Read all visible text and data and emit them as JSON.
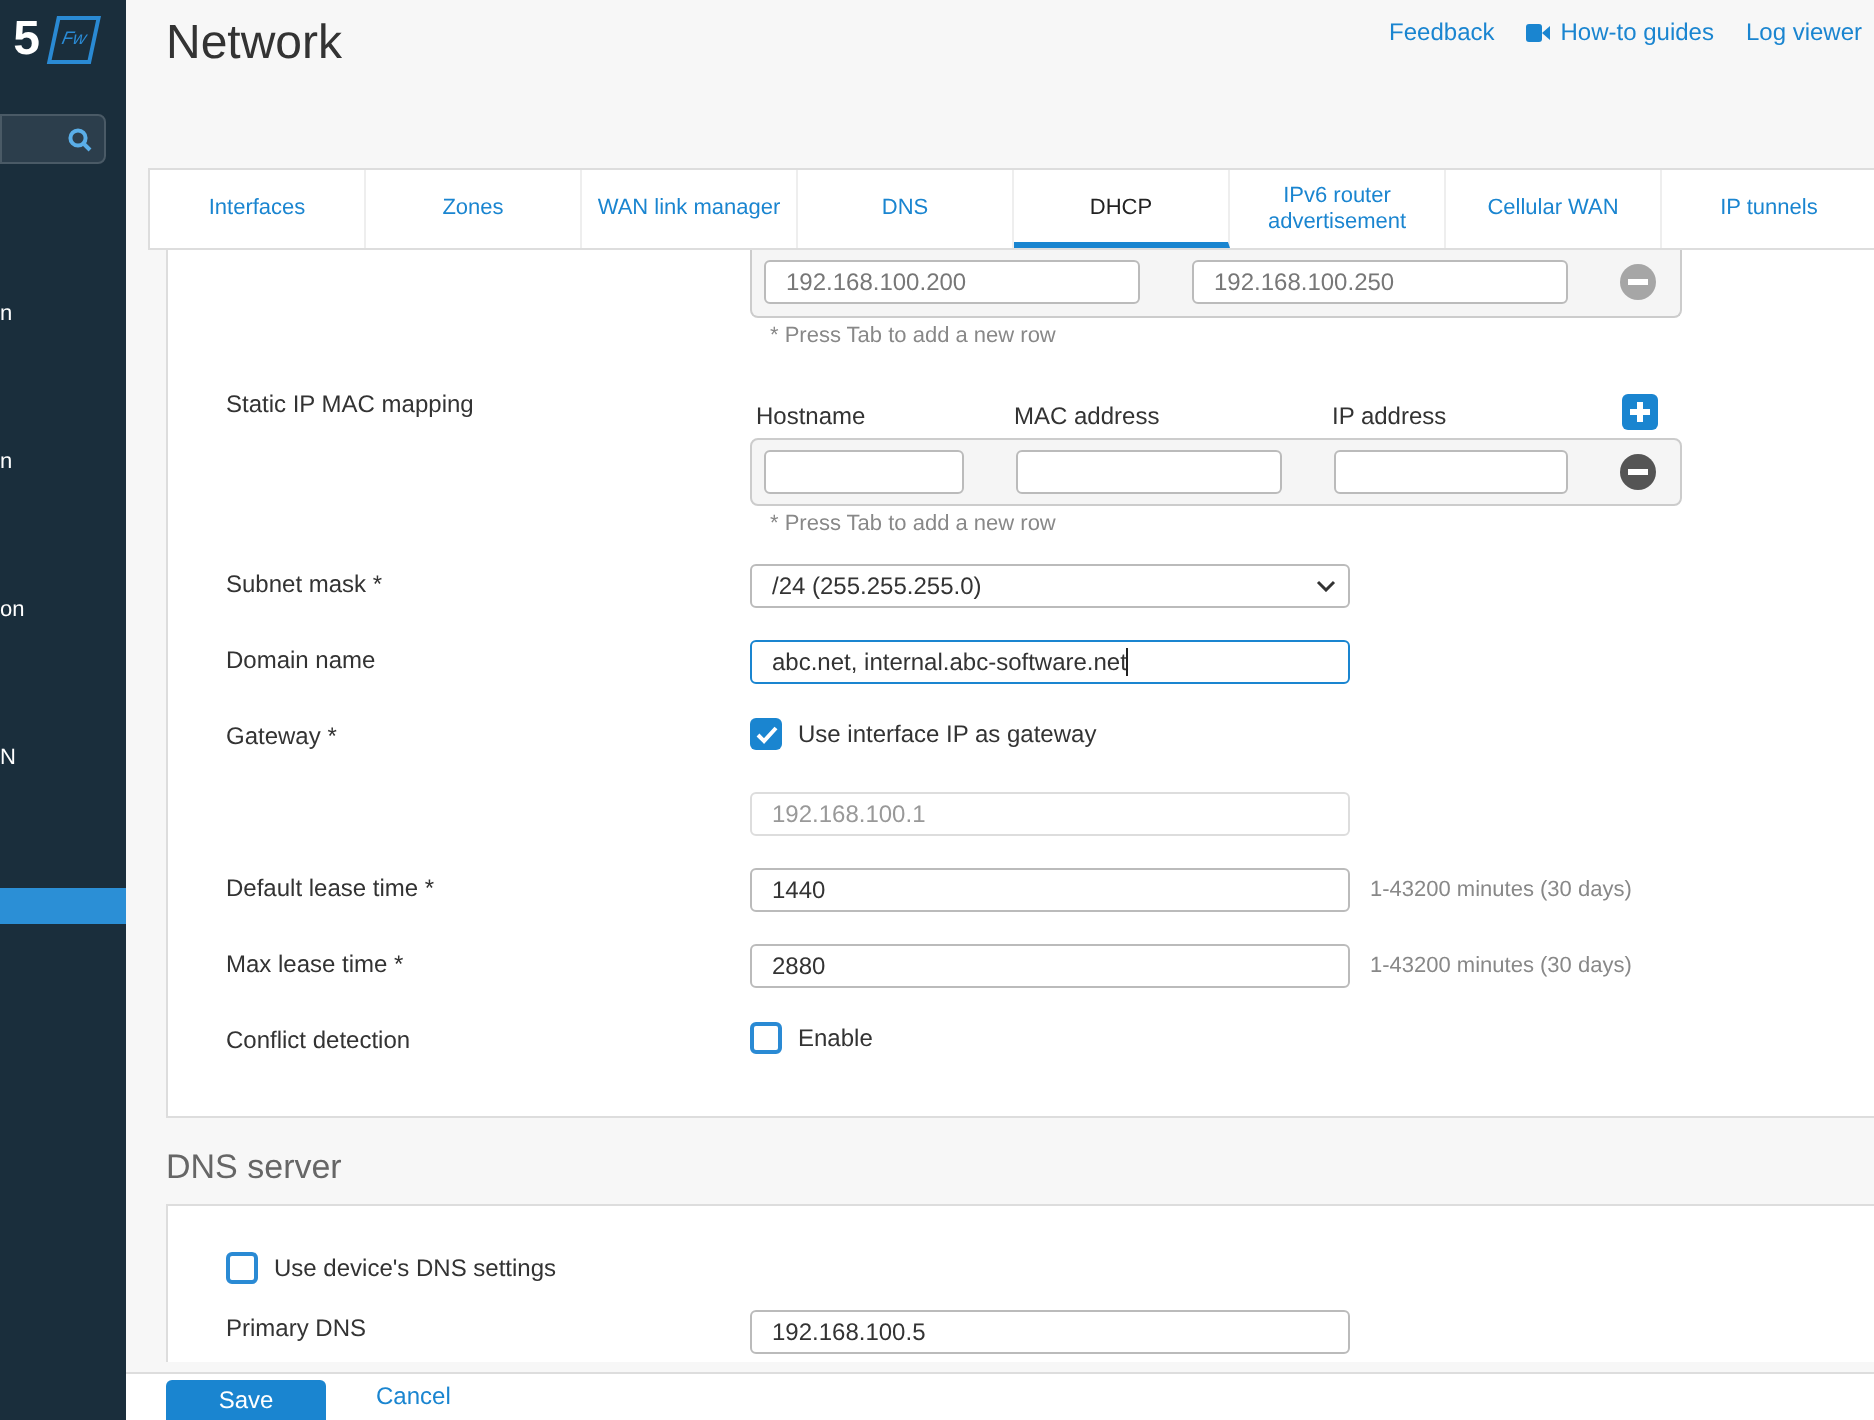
{
  "sidebar": {
    "logo": {
      "mark": "5",
      "badge": "Fw"
    },
    "items": [
      {
        "label": "n",
        "selected": false
      },
      {
        "label": "n",
        "selected": false
      },
      {
        "label": "on",
        "selected": false
      },
      {
        "label": "N",
        "selected": false
      },
      {
        "selected": true
      }
    ]
  },
  "header": {
    "title": "Network",
    "links": [
      {
        "label": "Feedback",
        "kind": "plain"
      },
      {
        "label": "How-to guides",
        "kind": "video"
      },
      {
        "label": "Log viewer",
        "kind": "plain"
      }
    ]
  },
  "tabs": [
    {
      "label": "Interfaces",
      "selected": false
    },
    {
      "label": "Zones",
      "selected": false
    },
    {
      "label": "WAN link manager",
      "selected": false
    },
    {
      "label": "DNS",
      "selected": false
    },
    {
      "label": "DHCP",
      "selected": true
    },
    {
      "label": "IPv6 router advertisement",
      "selected": false
    },
    {
      "label": "Cellular WAN",
      "selected": false
    },
    {
      "label": "IP tunnels",
      "selected": false
    }
  ],
  "dhcp": {
    "range_rows": [
      {
        "start": "192.168.100.200",
        "end": "192.168.100.250"
      }
    ],
    "range_hint": "* Press Tab to add a new row",
    "static_mapping": {
      "label": "Static IP MAC mapping",
      "columns": [
        "Hostname",
        "MAC address",
        "IP address"
      ],
      "hint": "* Press Tab to add a new row"
    },
    "fields": [
      {
        "kind": "select",
        "label": "Subnet mask *",
        "value": "/24 (255.255.255.0)"
      },
      {
        "kind": "text",
        "label": "Domain name",
        "value": "abc.net, internal.abc-software.net",
        "focused": true
      },
      {
        "kind": "checkbox",
        "label": "Gateway *",
        "text": "Use interface IP as gateway",
        "checked": true
      },
      {
        "kind": "text",
        "value": "192.168.100.1",
        "disabled": true
      },
      {
        "kind": "text",
        "label": "Default lease time *",
        "value": "1440",
        "hint": "1-43200 minutes (30 days)"
      },
      {
        "kind": "text",
        "label": "Max lease time *",
        "value": "2880",
        "hint": "1-43200 minutes (30 days)"
      },
      {
        "kind": "checkbox",
        "label": "Conflict detection",
        "text": "Enable",
        "checked": false
      }
    ]
  },
  "dns_server": {
    "title": "DNS server",
    "use_device": {
      "text": "Use device's DNS settings",
      "checked": false
    },
    "fields": [
      {
        "kind": "text",
        "label": "Primary DNS",
        "value": "192.168.100.5"
      }
    ]
  },
  "footer": {
    "buttons": [
      {
        "label": "Save",
        "kind": "primary"
      },
      {
        "label": "Cancel",
        "kind": "link"
      }
    ]
  }
}
